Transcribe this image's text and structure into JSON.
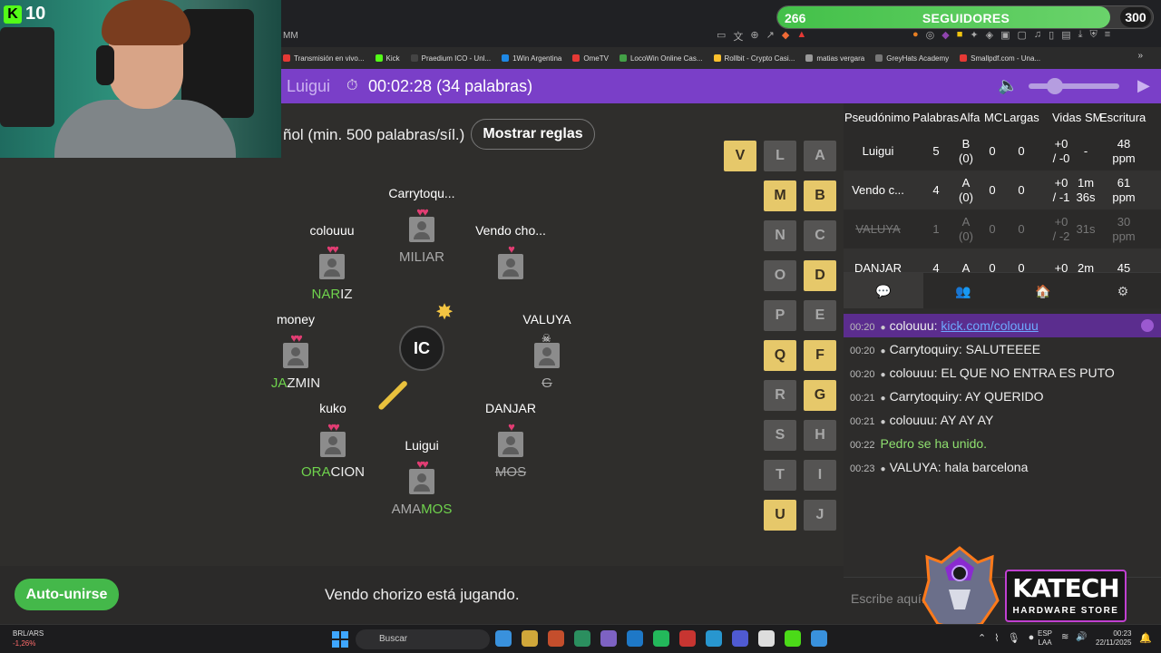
{
  "stream_overlay": {
    "kick_viewers": "10",
    "follow_current": "266",
    "follow_label": "SEGUIDORES",
    "follow_goal": "300",
    "follow_progress": 0.887
  },
  "browser": {
    "url_fragment": "MM",
    "bookmarks": [
      {
        "label": "Transmisión en vivo...",
        "color": "#e53935"
      },
      {
        "label": "Kick",
        "color": "#53fc18"
      },
      {
        "label": "Praedium ICO - Unl...",
        "color": "#444"
      },
      {
        "label": "1Win Argentina",
        "color": "#1e88e5"
      },
      {
        "label": "OmeTV",
        "color": "#e53935"
      },
      {
        "label": "LocoWin Online Cas...",
        "color": "#43a047"
      },
      {
        "label": "Rollbit - Crypto Casi...",
        "color": "#fbc02d"
      },
      {
        "label": "matias vergara",
        "color": "#999"
      },
      {
        "label": "GreyHats Academy",
        "color": "#777"
      },
      {
        "label": "Smallpdf.com - Una...",
        "color": "#e53935"
      }
    ],
    "bookmarks_more": "»"
  },
  "game_header": {
    "player_name": "Luigui",
    "timer_icon": "⏱",
    "timer_text": "00:02:28 (34 palabras)",
    "volume_icon": "🔈",
    "play_icon": "▶"
  },
  "rules": {
    "text": "ñol (min. 500 palabras/síl.)",
    "button": "Mostrar reglas"
  },
  "bomb": {
    "syllable": "IC"
  },
  "players": [
    {
      "name": "Carrytoqu...",
      "hearts": "♥♥",
      "word_hl": "",
      "word_rest": "MILIAR",
      "style": "dim"
    },
    {
      "name": "colouuu",
      "hearts": "♥♥",
      "word_hl": "NAR",
      "word_rest": "IZ",
      "style": "normal"
    },
    {
      "name": "Vendo cho...",
      "hearts": "♥",
      "word_hl": "",
      "word_rest": "",
      "style": "normal"
    },
    {
      "name": "money",
      "hearts": "♥♥",
      "word_hl": "JA",
      "word_rest": "ZMIN",
      "style": "normal"
    },
    {
      "name": "VALUYA",
      "hearts": "",
      "word_hl": "",
      "word_rest": "G",
      "style": "strike"
    },
    {
      "name": "kuko",
      "hearts": "♥♥",
      "word_hl": "ORA",
      "word_rest": "CION",
      "style": "normal"
    },
    {
      "name": "DANJAR",
      "hearts": "♥",
      "word_hl": "MOS",
      "word_rest": "",
      "style": "strikehl"
    },
    {
      "name": "Luigui",
      "hearts": "♥♥",
      "word_hl": "MOS",
      "word_rest": "AMA",
      "style": "suffix"
    }
  ],
  "letters": [
    {
      "l": "V",
      "on": true
    },
    {
      "l": "L",
      "on": false
    },
    {
      "l": "A",
      "on": false
    },
    {
      "l": "M",
      "on": true
    },
    {
      "l": "B",
      "on": true
    },
    {
      "l": "N",
      "on": false
    },
    {
      "l": "C",
      "on": false
    },
    {
      "l": "O",
      "on": false
    },
    {
      "l": "D",
      "on": true
    },
    {
      "l": "P",
      "on": false
    },
    {
      "l": "E",
      "on": false
    },
    {
      "l": "Q",
      "on": true
    },
    {
      "l": "F",
      "on": true
    },
    {
      "l": "R",
      "on": false
    },
    {
      "l": "G",
      "on": true
    },
    {
      "l": "S",
      "on": false
    },
    {
      "l": "H",
      "on": false
    },
    {
      "l": "T",
      "on": false
    },
    {
      "l": "I",
      "on": false
    },
    {
      "l": "U",
      "on": true
    },
    {
      "l": "J",
      "on": false
    }
  ],
  "auto_join": "Auto-unirse",
  "status_text": "Vendo chorizo está jugando.",
  "scoreboard": {
    "headers": [
      "Pseudónimo",
      "Palabras",
      "Alfa",
      "MC",
      "Largas",
      "Vidas",
      "SM",
      "Escritura"
    ],
    "rows": [
      {
        "name": "Luigui",
        "palabras": "5",
        "alfa": "B\n(0)",
        "mc": "0",
        "largas": "0",
        "vidas": "+0\n/ -0",
        "sm": "-",
        "escritura": "48\nppm",
        "faded": false
      },
      {
        "name": "Vendo c...",
        "palabras": "4",
        "alfa": "A\n(0)",
        "mc": "0",
        "largas": "0",
        "vidas": "+0\n/ -1",
        "sm": "1m\n36s",
        "escritura": "61\nppm",
        "faded": false
      },
      {
        "name": "VALUYA",
        "palabras": "1",
        "alfa": "A\n(0)",
        "mc": "0",
        "largas": "0",
        "vidas": "+0\n/ -2",
        "sm": "31s",
        "escritura": "30\nppm",
        "faded": true
      },
      {
        "name": "DANJAR",
        "palabras": "4",
        "alfa": "A",
        "mc": "0",
        "largas": "0",
        "vidas": "+0",
        "sm": "2m",
        "escritura": "45",
        "faded": false
      }
    ]
  },
  "chat_tabs": [
    "💬",
    "👥",
    "🏠",
    "⚙"
  ],
  "chat": [
    {
      "time": "00:20",
      "user": "colouuu:",
      "text": "",
      "link": "kick.com/colouuu",
      "highlight": true,
      "join": false
    },
    {
      "time": "00:20",
      "user": "Carrytoquiry:",
      "text": "SALUTEEEE",
      "link": "",
      "highlight": false,
      "join": false
    },
    {
      "time": "00:20",
      "user": "colouuu:",
      "text": "EL QUE NO ENTRA ES PUTO",
      "link": "",
      "highlight": false,
      "join": false
    },
    {
      "time": "00:21",
      "user": "Carrytoquiry:",
      "text": "AY QUERIDO",
      "link": "",
      "highlight": false,
      "join": false
    },
    {
      "time": "00:21",
      "user": "colouuu:",
      "text": "AY AY AY",
      "link": "",
      "highlight": false,
      "join": false
    },
    {
      "time": "00:22",
      "user": "Pedro",
      "text": " se ha unido.",
      "link": "",
      "highlight": false,
      "join": true
    },
    {
      "time": "00:23",
      "user": "VALUYA:",
      "text": "hala barcelona",
      "link": "",
      "highlight": false,
      "join": false
    }
  ],
  "chat_input_placeholder": "Escribe aquí...",
  "katech": {
    "name": "KATECH",
    "sub": "HARDWARE STORE"
  },
  "taskbar": {
    "ticker_name": "BRL/ARS",
    "ticker_change": "-1,26%",
    "search_label": "Buscar",
    "lang_top": "ESP",
    "lang_bottom": "LAA",
    "time": "00:23",
    "date": "22/11/2025",
    "app_colors": [
      "#3ea6ff",
      "#f0c040",
      "#e2572f",
      "#2ea36b",
      "#8e6fe0",
      "#1e88e5",
      "#25d366",
      "#e53935",
      "#2aabee",
      "#5865f2",
      "#fff",
      "#53fc18",
      "#3ea6ff"
    ]
  }
}
